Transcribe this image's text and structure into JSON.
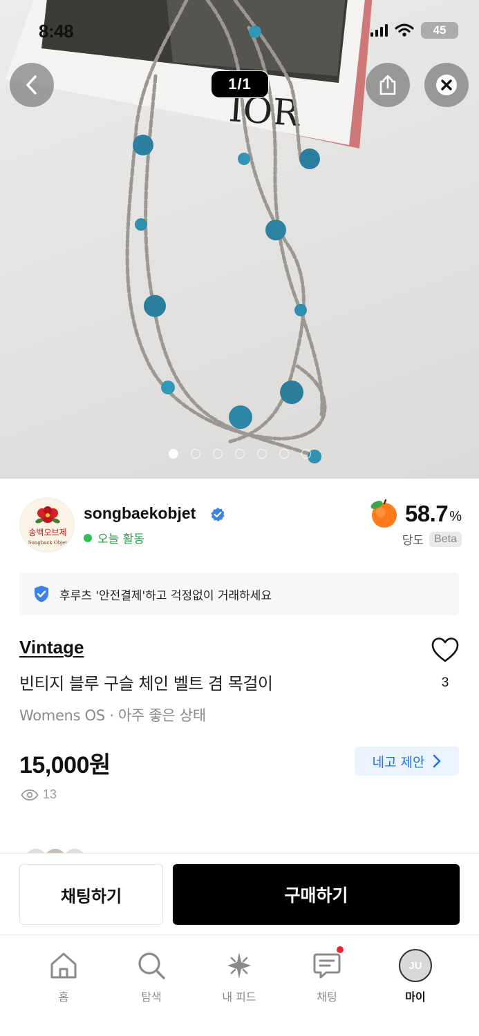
{
  "status_bar": {
    "time": "8:48",
    "battery": "45"
  },
  "photo": {
    "alt_icon": "product-photo",
    "counter": "1/1",
    "dot_count": 7
  },
  "seller": {
    "logo_text": "송백오브제",
    "logo_sub": "Songback Objet",
    "name": "songbaekobjet",
    "activity": "오늘 활동",
    "score": "58.7",
    "score_unit": "%",
    "score_label": "당도",
    "beta_label": "Beta"
  },
  "safe_banner": {
    "text": "후루츠 '안전결제'하고 걱정없이 거래하세요"
  },
  "product": {
    "brand": "Vintage",
    "title": "빈티지 블루 구슬 체인 벨트 겸 목걸이",
    "meta": "Womens OS · 아주 좋은 상태",
    "price": "15,000원",
    "offer_label": "네고 제안",
    "likes": "3",
    "views": "13"
  },
  "actions": {
    "chat_label": "채팅하기",
    "buy_label": "구매하기"
  },
  "tabs": [
    {
      "label": "홈",
      "icon": "home-icon"
    },
    {
      "label": "탐색",
      "icon": "search-icon"
    },
    {
      "label": "내 피드",
      "icon": "sparkle-icon"
    },
    {
      "label": "채팅",
      "icon": "chat-icon",
      "has_badge": true
    },
    {
      "label": "마이",
      "icon": "avatar",
      "avatar_initials": "JU"
    }
  ],
  "colors": {
    "accent_blue": "#1a73e8",
    "activity_green": "#2fbf55",
    "badge_red": "#e8262b"
  }
}
